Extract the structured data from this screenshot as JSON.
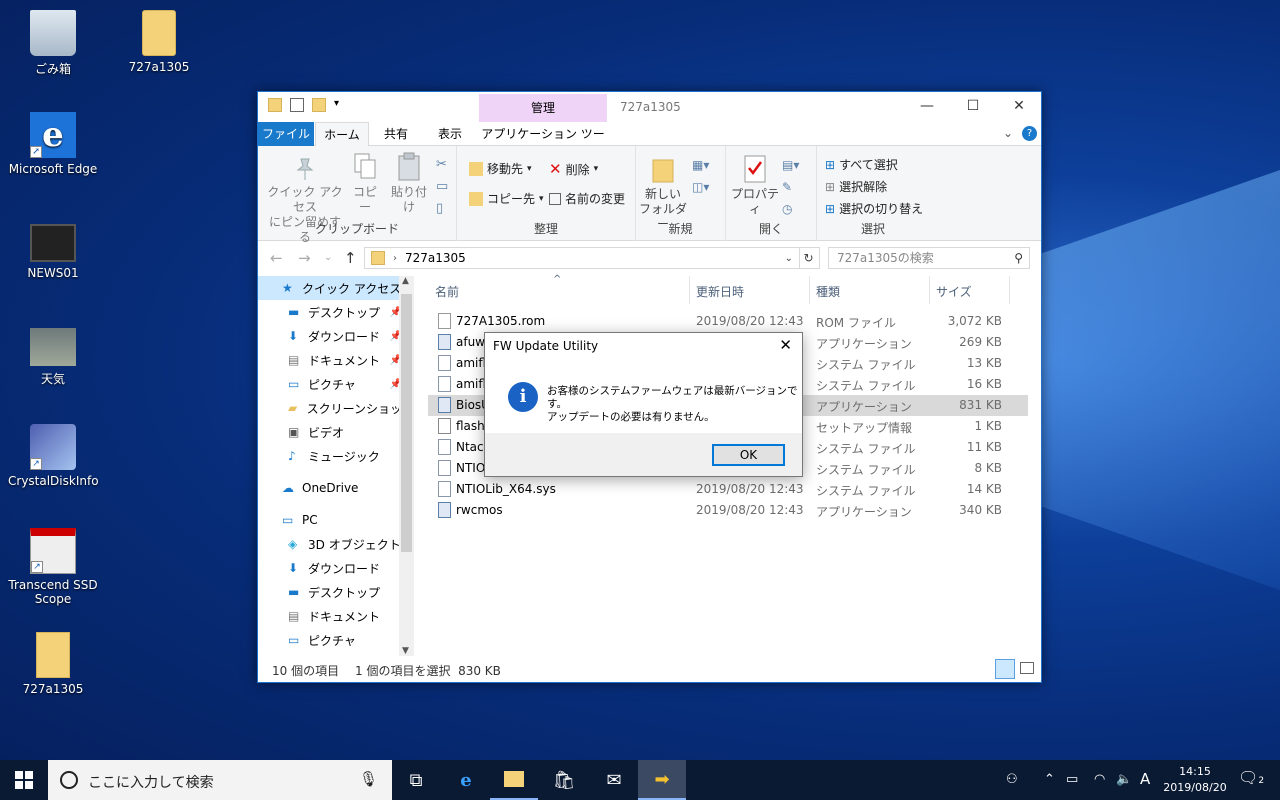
{
  "desktop": {
    "icons": [
      {
        "label": "ごみ箱",
        "icon": "recycle-bin-icon"
      },
      {
        "label": "727a1305",
        "icon": "folder-icon"
      },
      {
        "label": "Microsoft Edge",
        "icon": "edge-icon"
      },
      {
        "label": "NEWS01",
        "icon": "video-icon"
      },
      {
        "label": "天気",
        "icon": "weather-icon"
      },
      {
        "label": "CrystalDiskInfo",
        "icon": "crystaldiskinfo-icon"
      },
      {
        "label": "Transcend SSD Scope",
        "icon": "transcend-icon"
      },
      {
        "label": "727a1305",
        "icon": "zip-folder-icon"
      }
    ]
  },
  "explorer": {
    "title": "727a1305",
    "contextual_tab": "管理",
    "tabs": [
      "ファイル",
      "ホーム",
      "共有",
      "表示",
      "アプリケーション ツール"
    ],
    "ribbon": {
      "clipboard": {
        "pin": "クイック アクセス\nにピン留めする",
        "copy": "コピー",
        "paste": "貼り付け",
        "label": "クリップボード"
      },
      "organize": {
        "move": "移動先",
        "copy_to": "コピー先",
        "delete": "削除",
        "rename": "名前の変更",
        "label": "整理"
      },
      "new": {
        "new_folder": "新しい\nフォルダー",
        "label": "新規"
      },
      "open": {
        "properties": "プロパティ",
        "label": "開く"
      },
      "select": {
        "select_all": "すべて選択",
        "select_none": "選択解除",
        "invert": "選択の切り替え",
        "label": "選択"
      }
    },
    "address": "727a1305",
    "search_placeholder": "727a1305の検索",
    "nav": [
      {
        "label": "クイック アクセス",
        "icon": "star-icon",
        "pinned": false,
        "indent": 1
      },
      {
        "label": "デスクトップ",
        "icon": "desktop-icon",
        "pinned": true,
        "indent": 2
      },
      {
        "label": "ダウンロード",
        "icon": "download-icon",
        "pinned": true,
        "indent": 2
      },
      {
        "label": "ドキュメント",
        "icon": "document-icon",
        "pinned": true,
        "indent": 2
      },
      {
        "label": "ピクチャ",
        "icon": "picture-icon",
        "pinned": true,
        "indent": 2
      },
      {
        "label": "スクリーンショット",
        "icon": "folder-icon",
        "pinned": false,
        "indent": 2
      },
      {
        "label": "ビデオ",
        "icon": "video-icon",
        "pinned": false,
        "indent": 2
      },
      {
        "label": "ミュージック",
        "icon": "music-icon",
        "pinned": false,
        "indent": 2
      },
      {
        "label": "",
        "icon": "",
        "pinned": false,
        "indent": 0
      },
      {
        "label": "OneDrive",
        "icon": "onedrive-icon",
        "pinned": false,
        "indent": 1
      },
      {
        "label": "",
        "icon": "",
        "pinned": false,
        "indent": 0
      },
      {
        "label": "PC",
        "icon": "pc-icon",
        "pinned": false,
        "indent": 1
      },
      {
        "label": "3D オブジェクト",
        "icon": "3d-objects-icon",
        "pinned": false,
        "indent": 2
      },
      {
        "label": "ダウンロード",
        "icon": "download-icon",
        "pinned": false,
        "indent": 2
      },
      {
        "label": "デスクトップ",
        "icon": "desktop-icon",
        "pinned": false,
        "indent": 2
      },
      {
        "label": "ドキュメント",
        "icon": "document-icon",
        "pinned": false,
        "indent": 2
      },
      {
        "label": "ピクチャ",
        "icon": "picture-icon",
        "pinned": false,
        "indent": 2
      }
    ],
    "columns": {
      "name": "名前",
      "date": "更新日時",
      "type": "種類",
      "size": "サイズ"
    },
    "files": [
      {
        "name": "727A1305.rom",
        "date": "2019/08/20 12:43",
        "type": "ROM ファイル",
        "size": "3,072 KB",
        "icon": "file-icon"
      },
      {
        "name": "afuwin",
        "date": "",
        "type": "アプリケーション",
        "size": "269 KB",
        "icon": "app-icon"
      },
      {
        "name": "amifldrv32.sys",
        "date": "",
        "type": "システム ファイル",
        "size": "13 KB",
        "icon": "sys-file-icon"
      },
      {
        "name": "amifldrv64.sys",
        "date": "",
        "type": "システム ファイル",
        "size": "16 KB",
        "icon": "sys-file-icon"
      },
      {
        "name": "BiosUpdate",
        "date": "",
        "type": "アプリケーション",
        "size": "831 KB",
        "icon": "app-icon",
        "selected": true
      },
      {
        "name": "flash",
        "date": "",
        "type": "セットアップ情報",
        "size": "1 KB",
        "icon": "setup-file-icon"
      },
      {
        "name": "Ntacc",
        "date": "",
        "type": "システム ファイル",
        "size": "11 KB",
        "icon": "sys-file-icon"
      },
      {
        "name": "NTIOLib",
        "date": "",
        "type": "システム ファイル",
        "size": "8 KB",
        "icon": "sys-file-icon"
      },
      {
        "name": "NTIOLib_X64.sys",
        "date": "2019/08/20 12:43",
        "type": "システム ファイル",
        "size": "14 KB",
        "icon": "sys-file-icon"
      },
      {
        "name": "rwcmos",
        "date": "2019/08/20 12:43",
        "type": "アプリケーション",
        "size": "340 KB",
        "icon": "app-icon"
      }
    ],
    "status": {
      "count": "10 個の項目",
      "selection": "1 個の項目を選択  830 KB"
    }
  },
  "dialog": {
    "title": "FW Update Utility",
    "message_line1": "お客様のシステムファームウェアは最新バージョンです。",
    "message_line2": "アップデートの必要は有りません。",
    "ok": "OK"
  },
  "taskbar": {
    "search_placeholder": "ここに入力して検索",
    "time": "14:15",
    "date": "2019/08/20",
    "ime": "A",
    "notifications": "2"
  }
}
